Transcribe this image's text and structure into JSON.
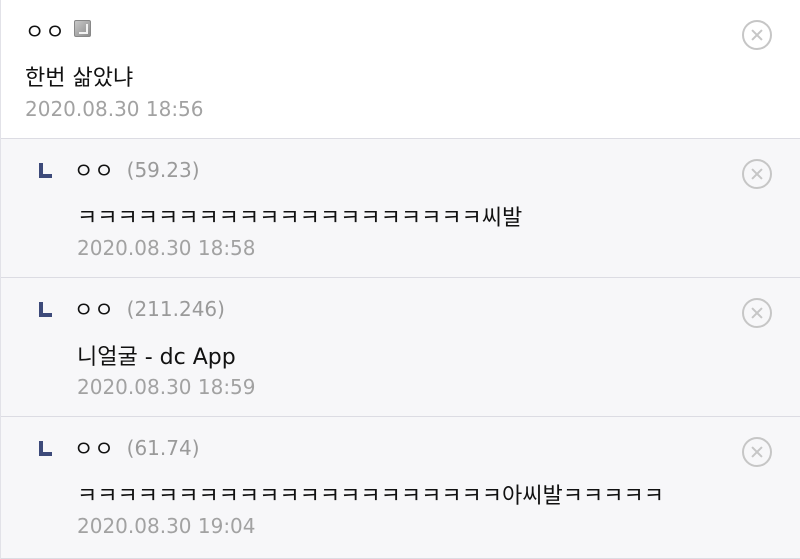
{
  "comments": [
    {
      "nickname": "ㅇㅇ",
      "ip": "",
      "text": "한번 삶았냐",
      "date": "2020.08.30 18:56"
    },
    {
      "nickname": "ㅇㅇ",
      "ip": "(59.23)",
      "text": "ㅋㅋㅋㅋㅋㅋㅋㅋㅋㅋㅋㅋㅋㅋㅋㅋㅋㅋㅋㅋ씨발",
      "date": "2020.08.30 18:58"
    },
    {
      "nickname": "ㅇㅇ",
      "ip": "(211.246)",
      "text": "니얼굴 - dc App",
      "date": "2020.08.30 18:59"
    },
    {
      "nickname": "ㅇㅇ",
      "ip": "(61.74)",
      "text": "ㅋㅋㅋㅋㅋㅋㅋㅋㅋㅋㅋㅋㅋㅋㅋㅋㅋㅋㅋㅋㅋ아씨발ㅋㅋㅋㅋㅋ",
      "date": "2020.08.30 19:04"
    }
  ],
  "icons": {
    "member_badge": "fixed-nickname-icon",
    "reply_marker": "reply-arrow-icon",
    "delete": "delete-circle-x-icon"
  },
  "colors": {
    "reply_background": "#f7f7f9",
    "reply_marker": "#3d4a7a",
    "meta_text": "#a2a2a2",
    "delete_icon": "#c6c6c6"
  }
}
